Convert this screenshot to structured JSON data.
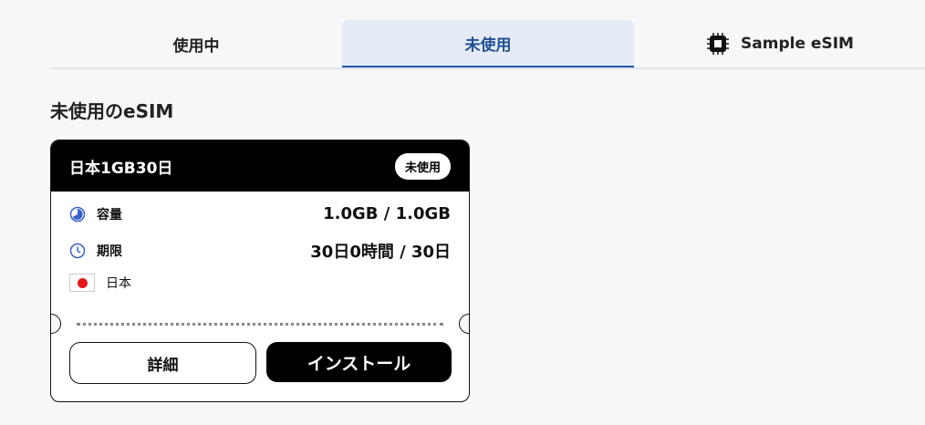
{
  "tabs": [
    {
      "label": "使用中"
    },
    {
      "label": "未使用"
    },
    {
      "label": "Sample eSIM"
    }
  ],
  "section": {
    "title": "未使用のeSIM"
  },
  "card": {
    "plan": "日本1GB30日",
    "badge": "未使用",
    "capacity_label": "容量",
    "capacity_value": "1.0GB / 1.0GB",
    "period_label": "期限",
    "period_value": "30日0時間 / 30日",
    "country": "日本",
    "detail_button": "詳細",
    "install_button": "インストール"
  },
  "colors": {
    "active_tab_bg": "#e6ebf8",
    "active_tab_text": "#1f4f93",
    "icon_blue": "#3b62c9",
    "flag_red": "#e5171a"
  },
  "icons": {
    "sample_tab": "chip-icon",
    "capacity": "pie-icon",
    "period": "clock-icon",
    "country": "japan-flag-icon"
  }
}
